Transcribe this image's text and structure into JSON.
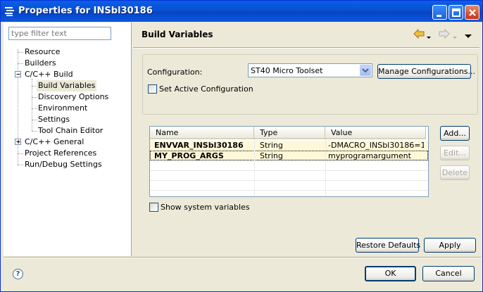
{
  "window": {
    "title": "Properties for INSbl30186"
  },
  "sidebar": {
    "filter_placeholder": "type filter text",
    "items": [
      {
        "label": "Resource"
      },
      {
        "label": "Builders"
      },
      {
        "label": "C/C++ Build"
      },
      {
        "label": "Build Variables"
      },
      {
        "label": "Discovery Options"
      },
      {
        "label": "Environment"
      },
      {
        "label": "Settings"
      },
      {
        "label": "Tool Chain Editor"
      },
      {
        "label": "C/C++ General"
      },
      {
        "label": "Project References"
      },
      {
        "label": "Run/Debug Settings"
      }
    ],
    "selected": "Build Variables"
  },
  "page": {
    "title": "Build Variables",
    "configuration_label": "Configuration:",
    "configuration_value": "ST40 Micro Toolset",
    "manage_button": "Manage Configurations...",
    "set_active_label": "Set Active Configuration",
    "show_system_label": "Show system variables"
  },
  "table": {
    "columns": [
      "Name",
      "Type",
      "Value"
    ],
    "rows": [
      {
        "name": "ENVVAR_INSbl30186",
        "type": "String",
        "value": "-DMACRO_INSbl30186=1"
      },
      {
        "name": "MY_PROG_ARGS",
        "type": "String",
        "value": "myprogramargument"
      }
    ]
  },
  "side_buttons": {
    "add": "Add...",
    "edit": "Edit...",
    "delete": "Delete"
  },
  "footer": {
    "restore_defaults": "Restore Defaults",
    "apply": "Apply",
    "ok": "OK",
    "cancel": "Cancel",
    "help_glyph": "?"
  },
  "colors": {
    "titlebar": "#0a5fe8",
    "dialog_bg": "#ece9d8",
    "row_highlight": "#fff8d8",
    "nav_back": "#e8b830"
  },
  "icons": {
    "window": "eclipse-properties-icon",
    "back": "back-arrow-icon",
    "forward": "forward-arrow-icon",
    "menu": "view-menu-icon",
    "help": "help-icon"
  }
}
